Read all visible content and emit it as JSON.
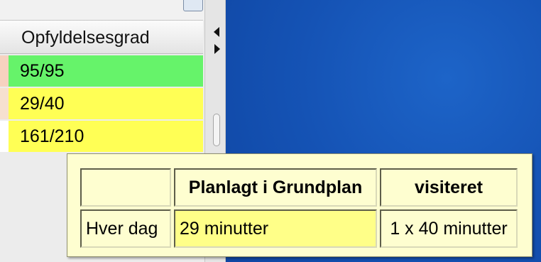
{
  "table": {
    "column_header": "Opfyldelsesgrad",
    "rows": [
      {
        "value": "95/95",
        "color": "#66f36a"
      },
      {
        "value": "29/40",
        "color": "#ffff55"
      },
      {
        "value": "161/210",
        "color": "#ffff55"
      }
    ]
  },
  "splitter": {
    "collapse_left_icon": "triangle-left",
    "expand_right_icon": "triangle-right"
  },
  "tooltip": {
    "header": [
      "",
      "Planlagt i Grundplan",
      "visiteret"
    ],
    "rows": [
      [
        "Hver dag",
        "29 minutter",
        "1 x 40 minutter"
      ]
    ]
  },
  "colors": {
    "desktop_blue": "#1553b5",
    "tooltip_bg": "#fefed0",
    "highlight_cell": "#ffff88"
  }
}
